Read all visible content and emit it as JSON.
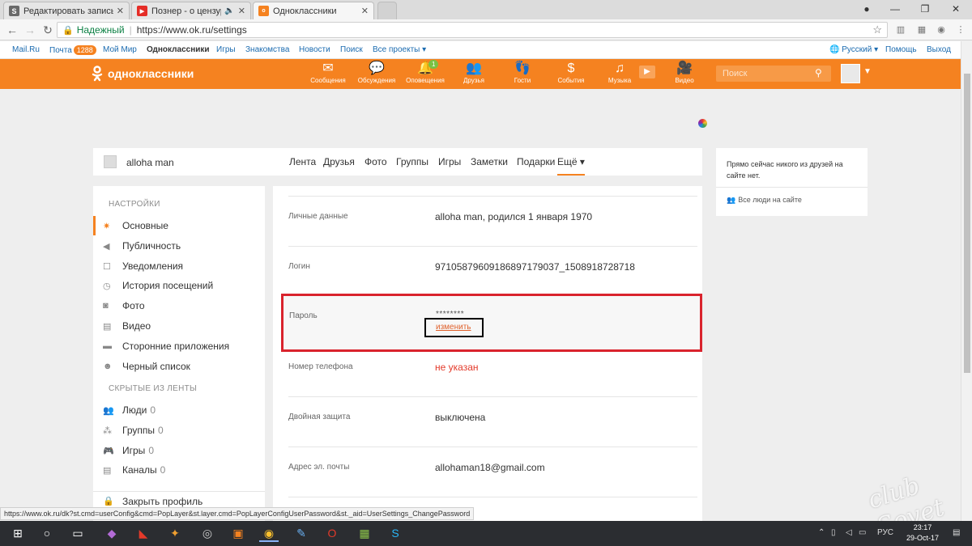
{
  "browser": {
    "tabs": [
      {
        "label": "Редактировать запись",
        "favicon_letter": "S",
        "favicon_color": "#6a6a6a"
      },
      {
        "label": "Познер - о цензуре,",
        "favicon_letter": "▶",
        "favicon_color": "#e52d27"
      },
      {
        "label": "Одноклассники",
        "favicon_letter": "ок",
        "favicon_color": "#f58220"
      }
    ],
    "secure_label": "Надежный",
    "url": "https://www.ok.ru/settings"
  },
  "portal_links": [
    {
      "label": "Mail.Ru"
    },
    {
      "label": "Почта",
      "badge": "1288"
    },
    {
      "label": "Мой Мир"
    },
    {
      "label": "Одноклассники",
      "bold": true
    },
    {
      "label": "Игры"
    },
    {
      "label": "Знакомства"
    },
    {
      "label": "Новости"
    },
    {
      "label": "Поиск"
    },
    {
      "label": "Все проекты ▾"
    }
  ],
  "portal_right": {
    "language": "Русский ▾",
    "help": "Помощь",
    "logout": "Выход"
  },
  "header": {
    "logo_text": "одноклассники",
    "nav": [
      {
        "label": "Сообщения",
        "icon": "envelope-icon"
      },
      {
        "label": "Обсуждения",
        "icon": "chat-icon"
      },
      {
        "label": "Оповещения",
        "icon": "bell-icon",
        "badge": "1"
      },
      {
        "label": "Друзья",
        "icon": "friends-icon"
      },
      {
        "label": "Гости",
        "icon": "footprints-icon"
      },
      {
        "label": "События",
        "icon": "events-icon"
      },
      {
        "label": "Музыка",
        "icon": "music-icon"
      },
      {
        "label": "Видео",
        "icon": "video-icon"
      }
    ],
    "search_placeholder": "Поиск"
  },
  "profile": {
    "name": "alloha man",
    "tabs": [
      "Лента",
      "Друзья",
      "Фото",
      "Группы",
      "Игры",
      "Заметки",
      "Подарки",
      "Ещё ▾"
    ]
  },
  "settings_menu": {
    "heading": "НАСТРОЙКИ",
    "items": [
      {
        "label": "Основные",
        "icon": "gear-icon",
        "active": true
      },
      {
        "label": "Публичность",
        "icon": "megaphone-icon"
      },
      {
        "label": "Уведомления",
        "icon": "notification-icon"
      },
      {
        "label": "История посещений",
        "icon": "history-icon"
      },
      {
        "label": "Фото",
        "icon": "camera-icon"
      },
      {
        "label": "Видео",
        "icon": "film-icon"
      },
      {
        "label": "Сторонние приложения",
        "icon": "apps-icon"
      },
      {
        "label": "Черный список",
        "icon": "blocked-user-icon"
      }
    ],
    "hidden_heading": "СКРЫТЫЕ ИЗ ЛЕНТЫ",
    "hidden_items": [
      {
        "label": "Люди",
        "count": "0",
        "icon": "people-icon"
      },
      {
        "label": "Группы",
        "count": "0",
        "icon": "groups-icon"
      },
      {
        "label": "Игры",
        "count": "0",
        "icon": "gamepad-icon"
      },
      {
        "label": "Каналы",
        "count": "0",
        "icon": "channels-icon"
      }
    ],
    "close_profile": "Закрыть профиль"
  },
  "settings_rows": [
    {
      "label": "Личные данные",
      "value": "alloha man, родился 1 января 1970"
    },
    {
      "label": "Логин",
      "value": "971058796091868971790​37_1508918728718"
    },
    {
      "label": "Номер телефона",
      "value": "не указан",
      "warn": true
    },
    {
      "label": "Двойная защита",
      "value": "выключена"
    },
    {
      "label": "Адрес эл. почты",
      "value": "allohaman18@gmail.com"
    }
  ],
  "password_row": {
    "label": "Пароль",
    "masked": "********",
    "change_link": "изменить"
  },
  "right_sidebar": {
    "text": "Прямо сейчас никого из друзей на сайте нет.",
    "link": "Все люди на сайте"
  },
  "status_url": "https://www.ok.ru/dk?st.cmd=userConfig&cmd=PopLayer&st.layer.cmd=PopLayerConfigUserPassword&st._aid=UserSettings_ChangePassword",
  "watermark": "club Sovet",
  "taskbar": {
    "lang": "РУС",
    "time": "23:17",
    "date": "29-Oct-17"
  },
  "colors": {
    "ok_orange": "#f58220",
    "highlight_red": "#d9232d",
    "warn_red": "#e33a2a"
  }
}
